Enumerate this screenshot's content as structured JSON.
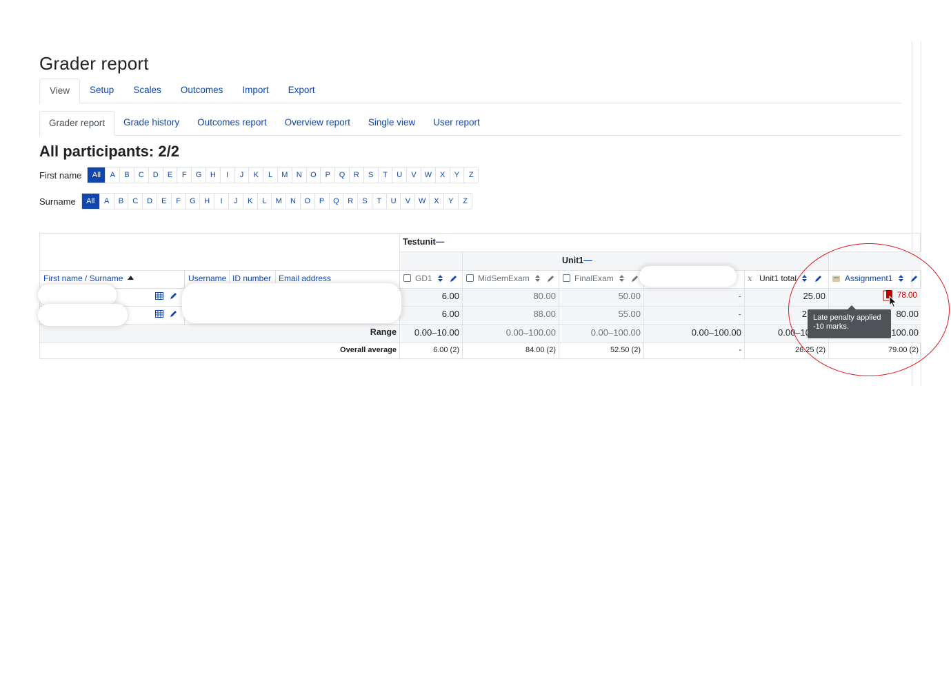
{
  "page": {
    "title": "Grader report"
  },
  "tabs_primary": [
    {
      "label": "View",
      "active": true
    },
    {
      "label": "Setup"
    },
    {
      "label": "Scales"
    },
    {
      "label": "Outcomes"
    },
    {
      "label": "Import"
    },
    {
      "label": "Export"
    }
  ],
  "tabs_secondary": [
    {
      "label": "Grader report",
      "active": true
    },
    {
      "label": "Grade history"
    },
    {
      "label": "Outcomes report"
    },
    {
      "label": "Overview report"
    },
    {
      "label": "Single view"
    },
    {
      "label": "User report"
    }
  ],
  "participants": {
    "heading": "All participants: 2/2"
  },
  "initials": {
    "first_name_label": "First name",
    "surname_label": "Surname",
    "letters": [
      "All",
      "A",
      "B",
      "C",
      "D",
      "E",
      "F",
      "G",
      "H",
      "I",
      "J",
      "K",
      "L",
      "M",
      "N",
      "O",
      "P",
      "Q",
      "R",
      "S",
      "T",
      "U",
      "V",
      "W",
      "X",
      "Y",
      "Z"
    ]
  },
  "grid": {
    "category_testunit": "Testunit",
    "category_unit1": "Unit1",
    "collapse_glyph": "—",
    "headers": {
      "name": "First name / Surname",
      "username": "Username",
      "id_number": "ID number",
      "email": "Email address",
      "gd1": "GD1",
      "midsem": "MidSemExam",
      "final": "FinalExam",
      "unit1_total": "Unit1 total",
      "assignment1": "Assignment1"
    },
    "rows": [
      {
        "gd1": "6.00",
        "midsem": "80.00",
        "final": "50.00",
        "blank": "-",
        "unit1_total": "25.00",
        "assignment1": "78.00"
      },
      {
        "gd1": "6.00",
        "midsem": "88.00",
        "final": "55.00",
        "blank": "-",
        "unit1_total": "2",
        "assignment1": "80.00"
      }
    ],
    "range": {
      "label": "Range",
      "gd1": "0.00–10.00",
      "midsem": "0.00–100.00",
      "final": "0.00–100.00",
      "blank": "0.00–100.00",
      "unit1_total": "0.00–10",
      "assignment1": "100.00"
    },
    "average": {
      "label": "Overall average",
      "gd1": "6.00 (2)",
      "midsem": "84.00 (2)",
      "final": "52.50 (2)",
      "blank": "-",
      "unit1_total": "26.25 (2)",
      "assignment1": "79.00 (2)"
    }
  },
  "tooltip": {
    "line1": "Late penalty applied",
    "line2": "-10 marks."
  },
  "colors": {
    "link": "#0f47ad",
    "penalty": "#c20000",
    "annotation": "#e0191d"
  },
  "icons": [
    "sort-asc-icon",
    "sort-icon",
    "edit-icon",
    "table-icon",
    "calculator-icon",
    "assignment-icon",
    "penalty-icon",
    "cursor-icon"
  ]
}
